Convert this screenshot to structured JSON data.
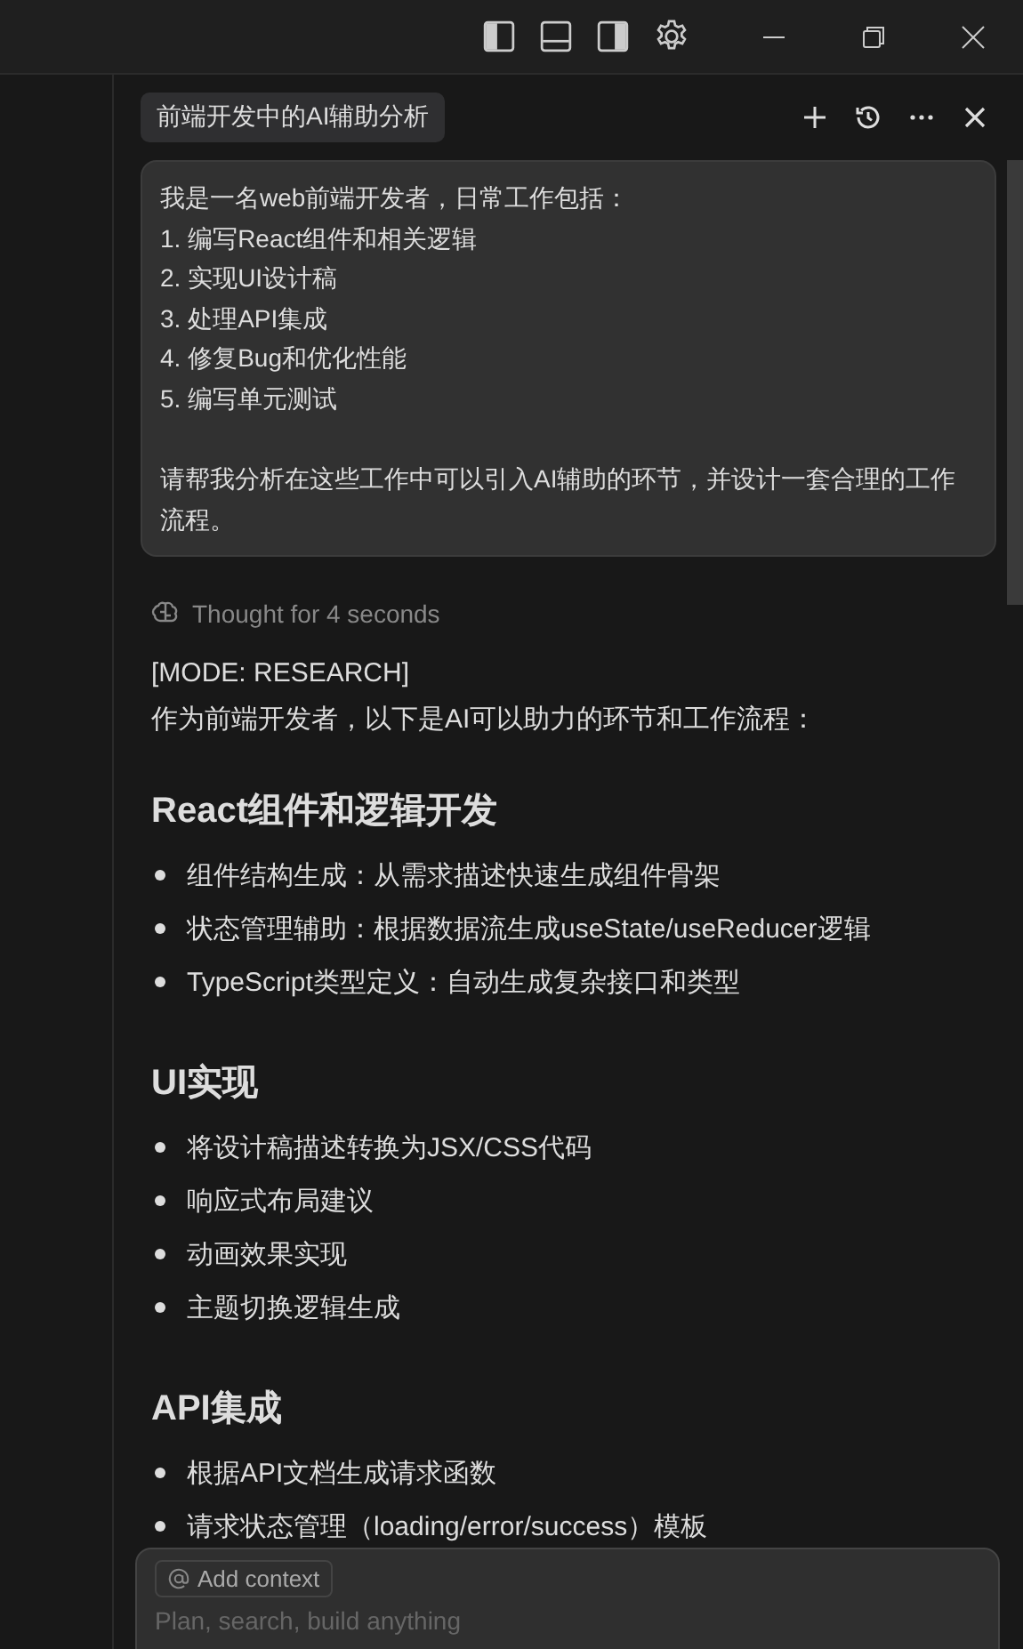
{
  "chat": {
    "title": "前端开发中的AI辅助分析"
  },
  "user_message": {
    "paragraphs": [
      [
        "我是一名web前端开发者，日常工作包括：",
        "1. 编写React组件和相关逻辑",
        "2. 实现UI设计稿",
        "3. 处理API集成",
        "4. 修复Bug和优化性能",
        "5. 编写单元测试"
      ],
      [
        "请帮我分析在这些工作中可以引入AI辅助的环节，并设计一套合理的工作流程。"
      ]
    ]
  },
  "thought": "Thought for 4 seconds",
  "response": {
    "mode": "[MODE: RESEARCH]",
    "intro": "作为前端开发者，以下是AI可以助力的环节和工作流程：",
    "sections": [
      {
        "heading": "React组件和逻辑开发",
        "items": [
          "组件结构生成：从需求描述快速生成组件骨架",
          "状态管理辅助：根据数据流生成useState/useReducer逻辑",
          "TypeScript类型定义：自动生成复杂接口和类型"
        ]
      },
      {
        "heading": "UI实现",
        "items": [
          "将设计稿描述转换为JSX/CSS代码",
          "响应式布局建议",
          "动画效果实现",
          "主题切换逻辑生成"
        ]
      },
      {
        "heading": "API集成",
        "items": [
          "根据API文档生成请求函数",
          "请求状态管理（loading/error/success）模板"
        ]
      }
    ]
  },
  "input": {
    "context_chip": "Add context",
    "placeholder": "Plan, search, build anything"
  }
}
